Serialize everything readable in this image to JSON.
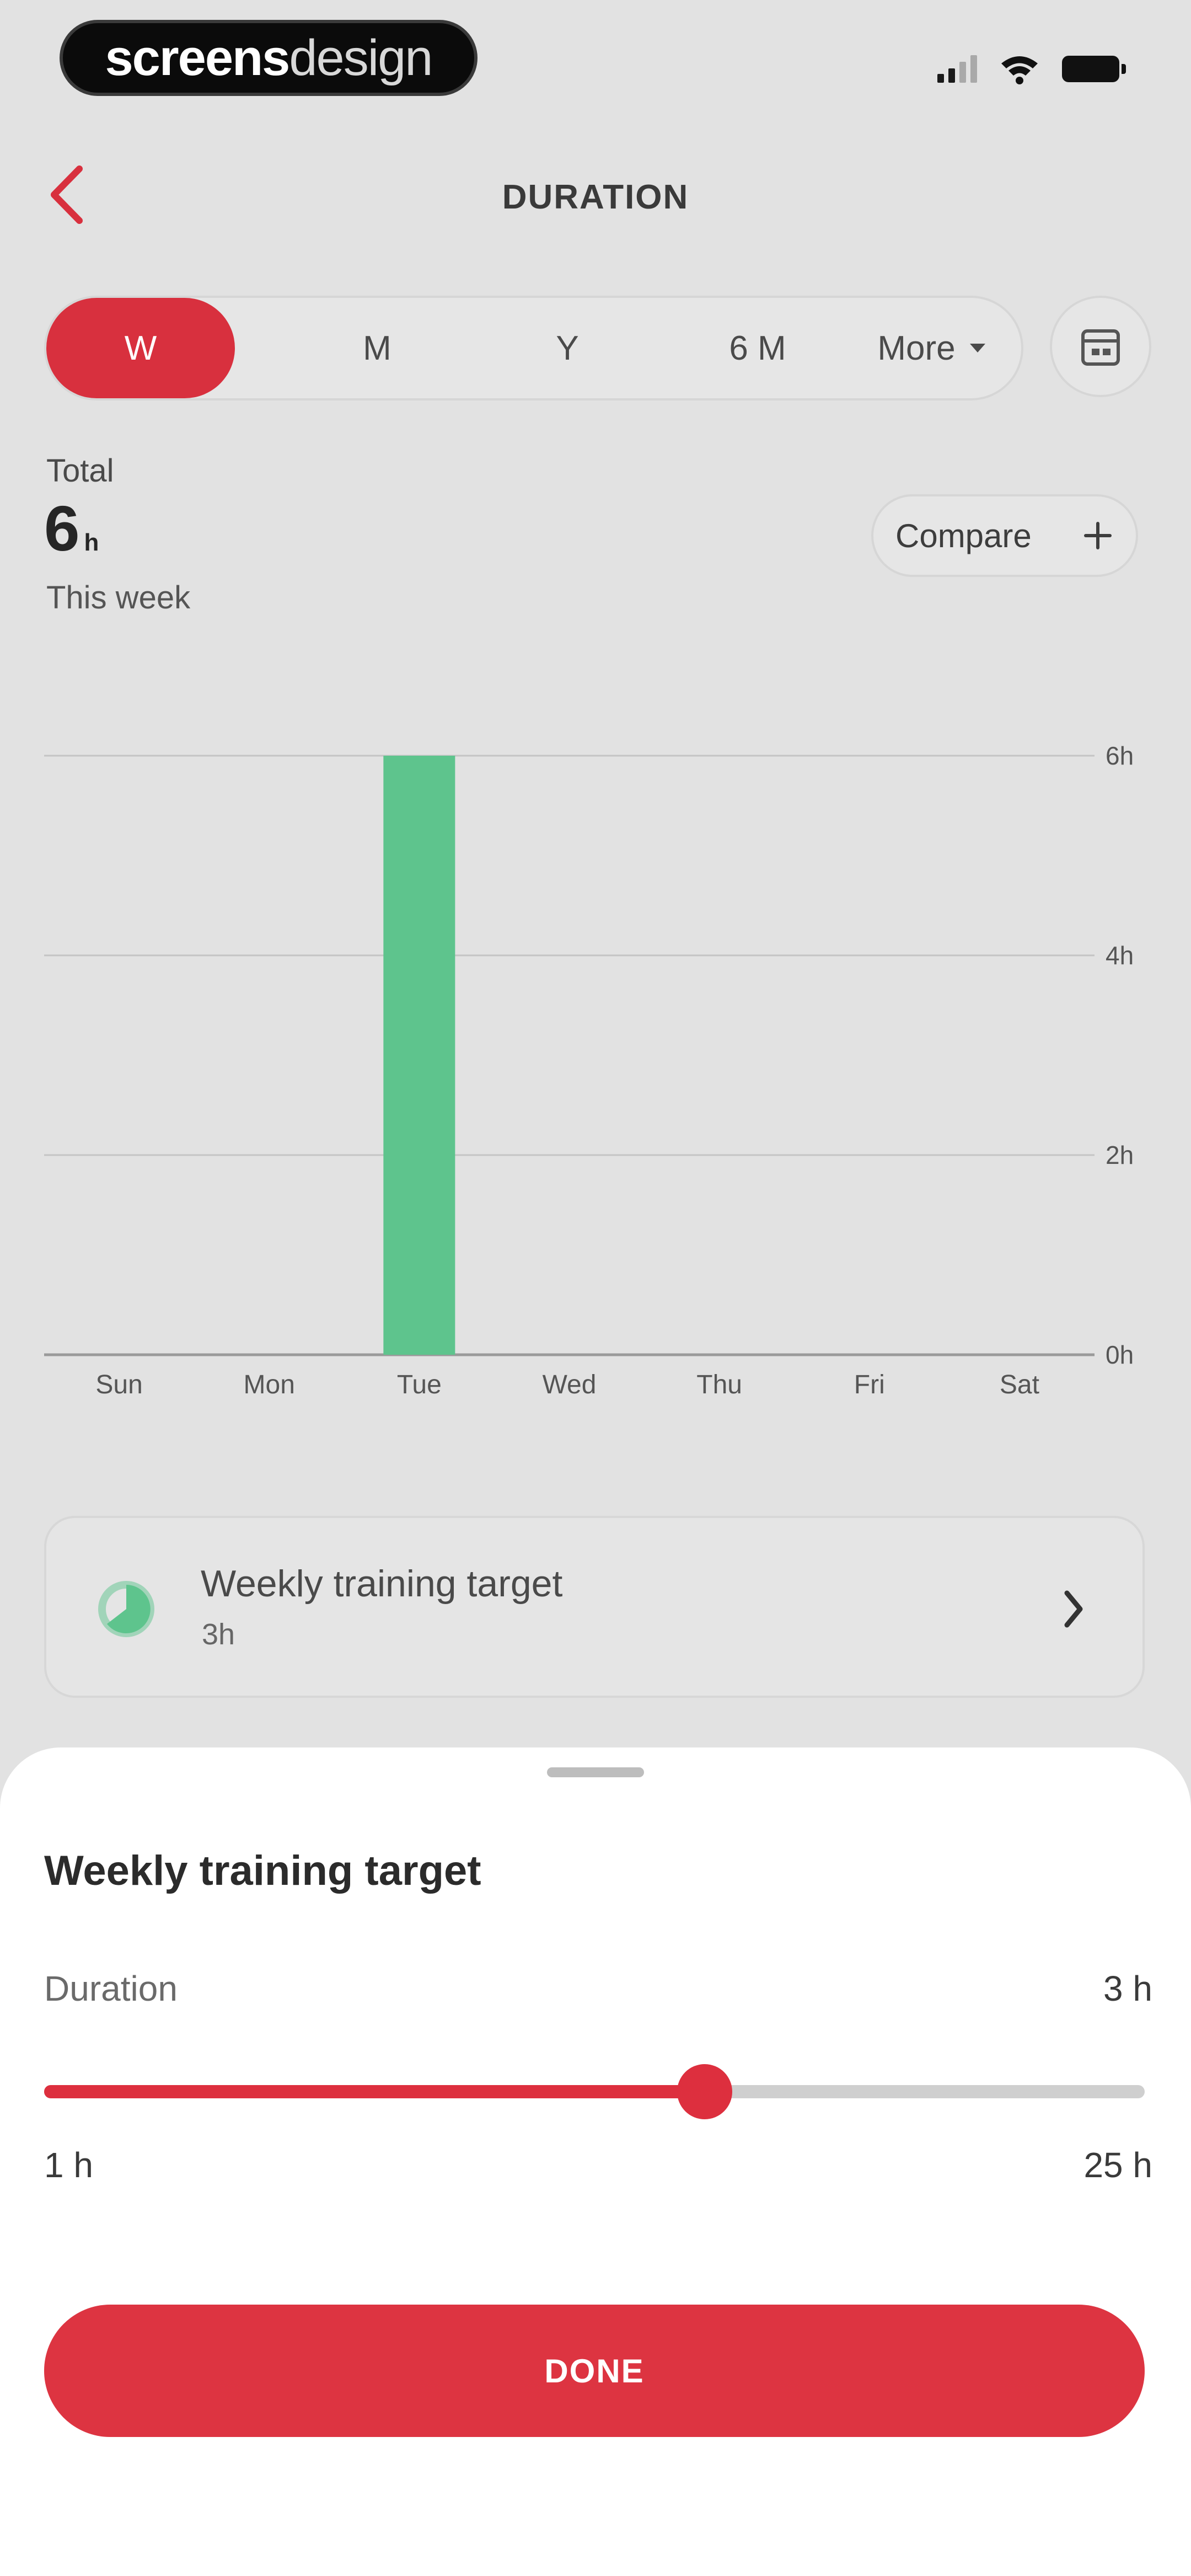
{
  "status_bar": {
    "logo_bold": "screens",
    "logo_light": "design"
  },
  "header": {
    "title": "DURATION",
    "back_icon": "chevron-left-icon"
  },
  "period_tabs": [
    {
      "label": "W",
      "active": true
    },
    {
      "label": "M",
      "active": false
    },
    {
      "label": "Y",
      "active": false
    },
    {
      "label": "6 M",
      "active": false
    },
    {
      "label": "More",
      "active": false
    }
  ],
  "calendar_icon": "calendar-icon",
  "summary": {
    "label": "Total",
    "value": "6",
    "unit": "h",
    "period": "This week",
    "compare_label": "Compare"
  },
  "chart_data": {
    "type": "bar",
    "categories": [
      "Sun",
      "Mon",
      "Tue",
      "Wed",
      "Thu",
      "Fri",
      "Sat"
    ],
    "values": [
      0,
      0,
      6,
      0,
      0,
      0,
      0
    ],
    "y_ticks": [
      "0h",
      "2h",
      "4h",
      "6h"
    ],
    "ylim": [
      0,
      6
    ],
    "grid": true,
    "axis_side": "right",
    "bar_color": "#5ec48d"
  },
  "target_card": {
    "title": "Weekly training target",
    "value": "3h",
    "icon": "progress-pie-icon"
  },
  "sheet": {
    "title": "Weekly training target",
    "duration_label": "Duration",
    "duration_value": "3 h",
    "slider": {
      "min": 1,
      "max": 25,
      "value": 3,
      "fill_fraction": 0.6
    },
    "min_label": "1 h",
    "max_label": "25 h",
    "done_label": "DONE"
  },
  "colors": {
    "accent": "#dd2f3e",
    "bar": "#5ec48d",
    "background": "#e2e2e2",
    "sheet": "#ffffff"
  }
}
